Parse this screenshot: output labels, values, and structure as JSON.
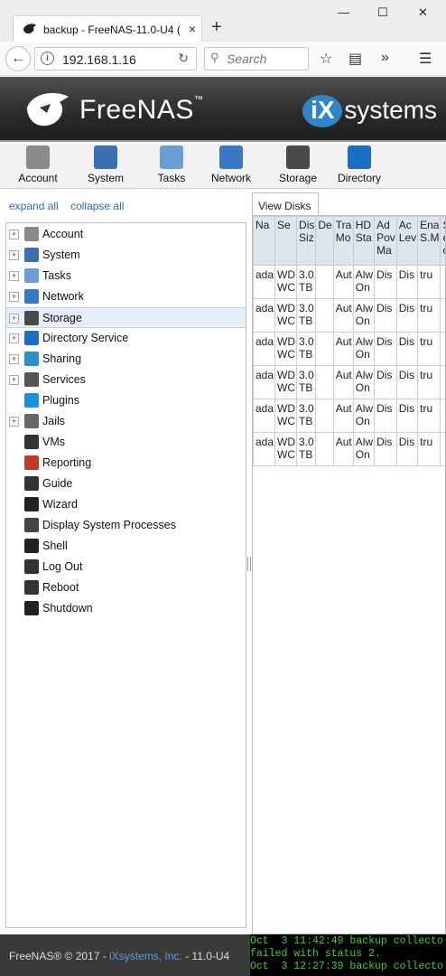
{
  "browser": {
    "tab_title": "backup - FreeNAS-11.0-U4 (",
    "url": "192.168.1.16",
    "search_placeholder": "Search",
    "new_tab": "+",
    "tab_close": "×",
    "minimize": "—",
    "maximize": "☐",
    "close": "✕"
  },
  "header": {
    "brand": "FreeNAS",
    "vendor_badge": "iX",
    "vendor_text": "systems"
  },
  "topnav": [
    {
      "label": "Account",
      "icon": "account-icon",
      "color": "#8a8a8a"
    },
    {
      "label": "System",
      "icon": "system-icon",
      "color": "#3b6fb0"
    },
    {
      "label": "Tasks",
      "icon": "tasks-icon",
      "color": "#6c9ed6"
    },
    {
      "label": "Network",
      "icon": "network-icon",
      "color": "#3a79c2"
    },
    {
      "label": "Storage",
      "icon": "storage-icon",
      "color": "#4a4a4a"
    },
    {
      "label": "Directory",
      "icon": "directory-icon",
      "color": "#1b6fc0"
    }
  ],
  "tree_links": {
    "expand": "expand all",
    "collapse": "collapse all"
  },
  "tree": [
    {
      "label": "Account",
      "expandable": true,
      "icon": "account-icon",
      "color": "#8a8a8a"
    },
    {
      "label": "System",
      "expandable": true,
      "icon": "system-icon",
      "color": "#3b6fb0"
    },
    {
      "label": "Tasks",
      "expandable": true,
      "icon": "tasks-icon",
      "color": "#6c9ed6"
    },
    {
      "label": "Network",
      "expandable": true,
      "icon": "network-icon",
      "color": "#3a79c2"
    },
    {
      "label": "Storage",
      "expandable": true,
      "icon": "storage-icon",
      "color": "#4a4a4a",
      "selected": true
    },
    {
      "label": "Directory Service",
      "expandable": true,
      "icon": "directory-icon",
      "color": "#1b6fc0"
    },
    {
      "label": "Sharing",
      "expandable": true,
      "icon": "sharing-icon",
      "color": "#2d8fd0"
    },
    {
      "label": "Services",
      "expandable": true,
      "icon": "services-icon",
      "color": "#555555"
    },
    {
      "label": "Plugins",
      "expandable": false,
      "icon": "plugins-icon",
      "color": "#1e8fe0"
    },
    {
      "label": "Jails",
      "expandable": true,
      "icon": "jails-icon",
      "color": "#666666"
    },
    {
      "label": "VMs",
      "expandable": false,
      "icon": "vms-icon",
      "color": "#333333"
    },
    {
      "label": "Reporting",
      "expandable": false,
      "icon": "reporting-icon",
      "color": "#c0392b"
    },
    {
      "label": "Guide",
      "expandable": false,
      "icon": "guide-icon",
      "color": "#333333"
    },
    {
      "label": "Wizard",
      "expandable": false,
      "icon": "wizard-icon",
      "color": "#222222"
    },
    {
      "label": "Display System Processes",
      "expandable": false,
      "icon": "processes-icon",
      "color": "#444444"
    },
    {
      "label": "Shell",
      "expandable": false,
      "icon": "shell-icon",
      "color": "#222222"
    },
    {
      "label": "Log Out",
      "expandable": false,
      "icon": "logout-icon",
      "color": "#333333"
    },
    {
      "label": "Reboot",
      "expandable": false,
      "icon": "reboot-icon",
      "color": "#333333"
    },
    {
      "label": "Shutdown",
      "expandable": false,
      "icon": "shutdown-icon",
      "color": "#222222"
    }
  ],
  "right_tab": "View Disks",
  "disks_table": {
    "headers": [
      "Na",
      "Se",
      "Dis Siz",
      "De",
      "Tra Mo",
      "HD Sta",
      "Ad Pov Ma",
      "Ac Lev",
      "Ena S.M",
      "S.M ext opt"
    ],
    "rows": [
      [
        "ada",
        "WD WC",
        "3.0 TB",
        "",
        "Aut",
        "Alw On",
        "Dis",
        "Dis",
        "tru",
        ""
      ],
      [
        "ada",
        "WD WC",
        "3.0 TB",
        "",
        "Aut",
        "Alw On",
        "Dis",
        "Dis",
        "tru",
        ""
      ],
      [
        "ada",
        "WD WC",
        "3.0 TB",
        "",
        "Aut",
        "Alw On",
        "Dis",
        "Dis",
        "tru",
        ""
      ],
      [
        "ada",
        "WD WC",
        "3.0 TB",
        "",
        "Aut",
        "Alw On",
        "Dis",
        "Dis",
        "tru",
        ""
      ],
      [
        "ada",
        "WD WC",
        "3.0 TB",
        "",
        "Aut",
        "Alw On",
        "Dis",
        "Dis",
        "tru",
        ""
      ],
      [
        "ada",
        "WD WC",
        "3.0 TB",
        "",
        "Aut",
        "Alw On",
        "Dis",
        "Dis",
        "tru",
        ""
      ]
    ]
  },
  "footer": {
    "copyright": "FreeNAS® © 2017 - ",
    "company": "iXsystems, Inc.",
    "version": " - 11.0-U4"
  },
  "console_lines": [
    "Oct  3 11:42:49 backup collecto",
    "failed with status 2.",
    "Oct  3 12:27:39 backup collecto"
  ]
}
